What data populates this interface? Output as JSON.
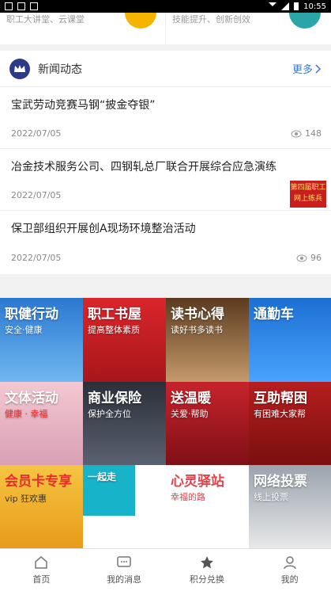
{
  "status_bar": {
    "time": "10:55",
    "battery": "battery-icon",
    "signal": "signal-icon",
    "wifi": "wifi-icon"
  },
  "top_cards": [
    {
      "subtitle": "职工大讲堂、云课堂",
      "icon_color": "#f5b400"
    },
    {
      "subtitle": "技能提升、创新创效",
      "icon_color": "#2aa5a8"
    }
  ],
  "news": {
    "section_title": "新闻动态",
    "more_label": "更多",
    "items": [
      {
        "headline": "宝武劳动竞赛马钢“披金夺银”",
        "date": "2022/07/05",
        "views": "148"
      },
      {
        "headline": "冶金技术服务公司、四钢轧总厂联合开展综合应急演练",
        "date": "2022/07/05",
        "thumb_text": "第四届职工网上练兵"
      },
      {
        "headline": "保卫部组织开展创A现场环境整治活动",
        "date": "2022/07/05",
        "views": "96"
      }
    ]
  },
  "tiles": [
    {
      "title": "职健行动",
      "sub": "安全·健康",
      "color": "#2b78d0"
    },
    {
      "title": "职工书屋",
      "sub": "提高整体素质",
      "color": "#d9262b"
    },
    {
      "title": "读书心得",
      "sub": "读好书多读书",
      "color": "#8a5a2b"
    },
    {
      "title": "通勤车",
      "sub": "",
      "color": "#1b6fd1"
    },
    {
      "title": "文体活动",
      "sub": "健康 · 幸福",
      "color": "#e6a6b6"
    },
    {
      "title": "商业保险",
      "sub": "保护全方位",
      "color": "#3a3f4a"
    },
    {
      "title": "送温暖",
      "sub": "关爱·帮助",
      "color": "#c8232c"
    },
    {
      "title": "互助帮困",
      "sub": "有困难大家帮",
      "color": "#b51e1e"
    },
    {
      "title": "会员卡专享",
      "sub": "vip 狂欢惠",
      "color": "#f0b52a"
    },
    {
      "title": "一起走",
      "sub": "",
      "color": "#17b3c9"
    },
    {
      "title": "心灵驿站",
      "sub": "幸福的路",
      "color": "#ffffff"
    },
    {
      "title": "网络投票",
      "sub": "线上投票",
      "color": "#9aa3ad"
    }
  ],
  "bottom_nav": [
    {
      "label": "首页",
      "icon": "home-icon"
    },
    {
      "label": "我的消息",
      "icon": "message-icon"
    },
    {
      "label": "积分兑换",
      "icon": "star-icon"
    },
    {
      "label": "我的",
      "icon": "user-icon"
    }
  ]
}
